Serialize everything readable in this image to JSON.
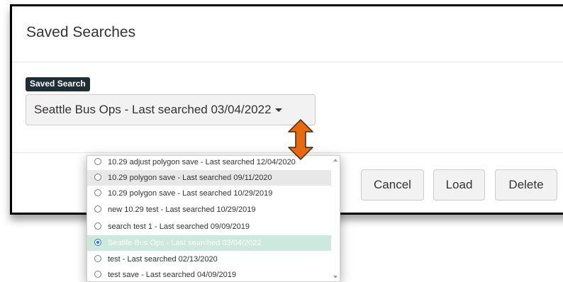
{
  "modal": {
    "title": "Saved Searches",
    "close_glyph": "×"
  },
  "field": {
    "label": "Saved Search",
    "selected_value": "Seattle Bus Ops - Last searched 03/04/2022"
  },
  "footer": {
    "cancel_label": "Cancel",
    "load_label": "Load",
    "delete_label": "Delete"
  },
  "dropdown": {
    "options": [
      "10.29 adjust polygon save - Last searched 12/04/2020",
      "10.29 polygon save - Last searched 09/11/2020",
      "10.29 polygon save - Last searched 10/29/2019",
      "new 10.29 test - Last searched 10/29/2019",
      "search test 1 - Last searched 09/09/2019",
      "Seattle Bus Ops - Last searched 03/04/2022",
      "test - Last searched 02/13/2020",
      "test save - Last searched 04/09/2019"
    ],
    "hovered_index": 1,
    "selected_index": 5
  },
  "colors": {
    "label_bg": "#1f2d36",
    "selected_bg": "#cde9dd",
    "annotation_arrow": "#e8690b"
  },
  "icons": {
    "close": "close-icon",
    "caret": "caret-down-icon",
    "annotation": "double-arrow-icon"
  }
}
